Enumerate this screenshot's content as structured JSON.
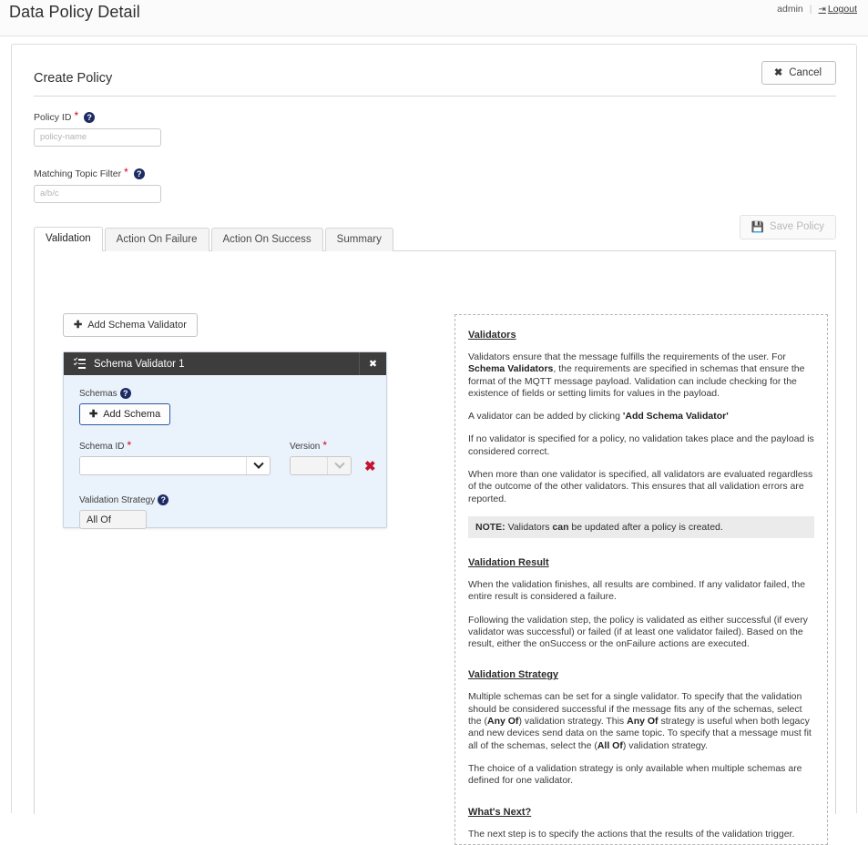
{
  "topbar": {
    "title": "Data Policy Detail",
    "user": "admin",
    "divider": "|",
    "logout_label": "Logout",
    "logout_icon": "sign-out-icon"
  },
  "section": {
    "title": "Create Policy",
    "cancel_label": "Cancel",
    "cancel_icon": "close-icon"
  },
  "fields": {
    "policy_id": {
      "label": "Policy ID",
      "required_marker": "*",
      "help_icon": "question-mark-icon",
      "value": "",
      "placeholder": "policy-name"
    },
    "topic_filter": {
      "label": "Matching Topic Filter",
      "required_marker": "*",
      "help_icon": "question-mark-icon",
      "value": "",
      "placeholder": "a/b/c"
    }
  },
  "tabs": [
    {
      "label": "Validation",
      "active": true
    },
    {
      "label": "Action On Failure",
      "active": false
    },
    {
      "label": "Action On Success",
      "active": false
    },
    {
      "label": "Summary",
      "active": false
    }
  ],
  "save_policy": {
    "label": "Save Policy",
    "icon": "save-disk-icon",
    "disabled": true
  },
  "validation_tab": {
    "add_validator_label": "Add Schema Validator",
    "add_validator_icon": "plus-icon",
    "validator": {
      "title": "Schema Validator 1",
      "title_icon": "list-check-icon",
      "close_icon": "close-icon",
      "schemas_label": "Schemas",
      "schemas_help_icon": "question-mark-icon",
      "add_schema_label": "Add Schema",
      "add_schema_icon": "plus-icon",
      "schema_id_label": "Schema ID",
      "schema_id_required": "*",
      "schema_id_value": "",
      "version_label": "Version",
      "version_required": "*",
      "version_value": "",
      "delete_row_icon": "delete-x-icon",
      "strategy_label": "Validation Strategy",
      "strategy_help_icon": "question-mark-icon",
      "strategy_value": "All Of"
    }
  },
  "doc_panel": {
    "validators_heading": "Validators",
    "validators_p1_a": "Validators ensure that the message fulfills the requirements of the user. For ",
    "validators_p1_b": "Schema Validators",
    "validators_p1_c": ", the requirements are specified in schemas that ensure the format of the MQTT message payload. Validation can include checking for the existence of fields or setting limits for values in the payload.",
    "validators_p2_a": "A validator can be added by clicking ",
    "validators_p2_b": "'Add Schema Validator'",
    "validators_p3": "If no validator is specified for a policy, no validation takes place and the payload is considered correct.",
    "validators_p4": "When more than one validator is specified, all validators are evaluated regardless of the outcome of the other validators. This ensures that all validation errors are reported.",
    "note_label": "NOTE:",
    "note_a": " Validators ",
    "note_b": "can",
    "note_c": " be updated after a policy is created.",
    "result_heading": "Validation Result",
    "result_p1": "When the validation finishes, all results are combined. If any validator failed, the entire result is considered a failure.",
    "result_p2": "Following the validation step, the policy is validated as either successful (if every validator was successful) or failed (if at least one validator failed). Based on the result, either the onSuccess or the onFailure actions are executed.",
    "strategy_heading": "Validation Strategy",
    "strategy_p1_a": "Multiple schemas can be set for a single validator. To specify that the validation should be considered successful if the message fits any of the schemas, select the (",
    "strategy_p1_b": "Any Of",
    "strategy_p1_c": ") validation strategy. This ",
    "strategy_p1_d": "Any Of",
    "strategy_p1_e": " strategy is useful when both legacy and new devices send data on the same topic. To specify that a message must fit all of the schemas, select the (",
    "strategy_p1_f": "All Of",
    "strategy_p1_g": ") validation strategy.",
    "strategy_p2": "The choice of a validation strategy is only available when multiple schemas are defined for one validator.",
    "next_heading": "What's Next?",
    "next_p": "The next step is to specify the actions that the results of the validation trigger."
  },
  "colors": {
    "accent_blue": "#1d2b64",
    "card_blue": "#eaf2fb",
    "header_dark": "#3d3d3d",
    "required_red": "#d0021b",
    "delete_red": "#c4122f"
  }
}
